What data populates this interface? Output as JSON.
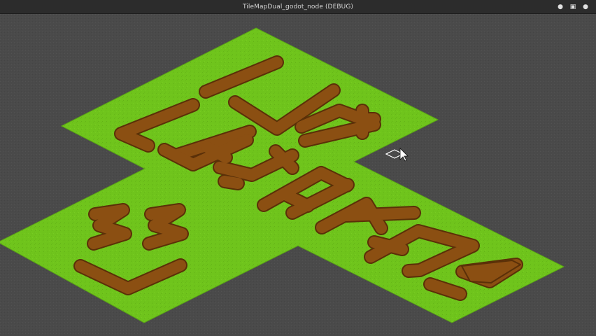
{
  "window": {
    "title": "TileMapDual_godot_node (DEBUG)",
    "controls": {
      "minimize": "●",
      "maximize": "▣",
      "close": "●"
    }
  },
  "viewport": {
    "colors": {
      "background": "#4a4a4a",
      "grass": "#6fc41c",
      "grass_edge": "#5aa515",
      "dirt": "#8b4f12",
      "dirt_edge": "#5a3008"
    },
    "cursor": "mouse-pointer-icon",
    "cursor_overlay": "tile-highlight-icon"
  }
}
